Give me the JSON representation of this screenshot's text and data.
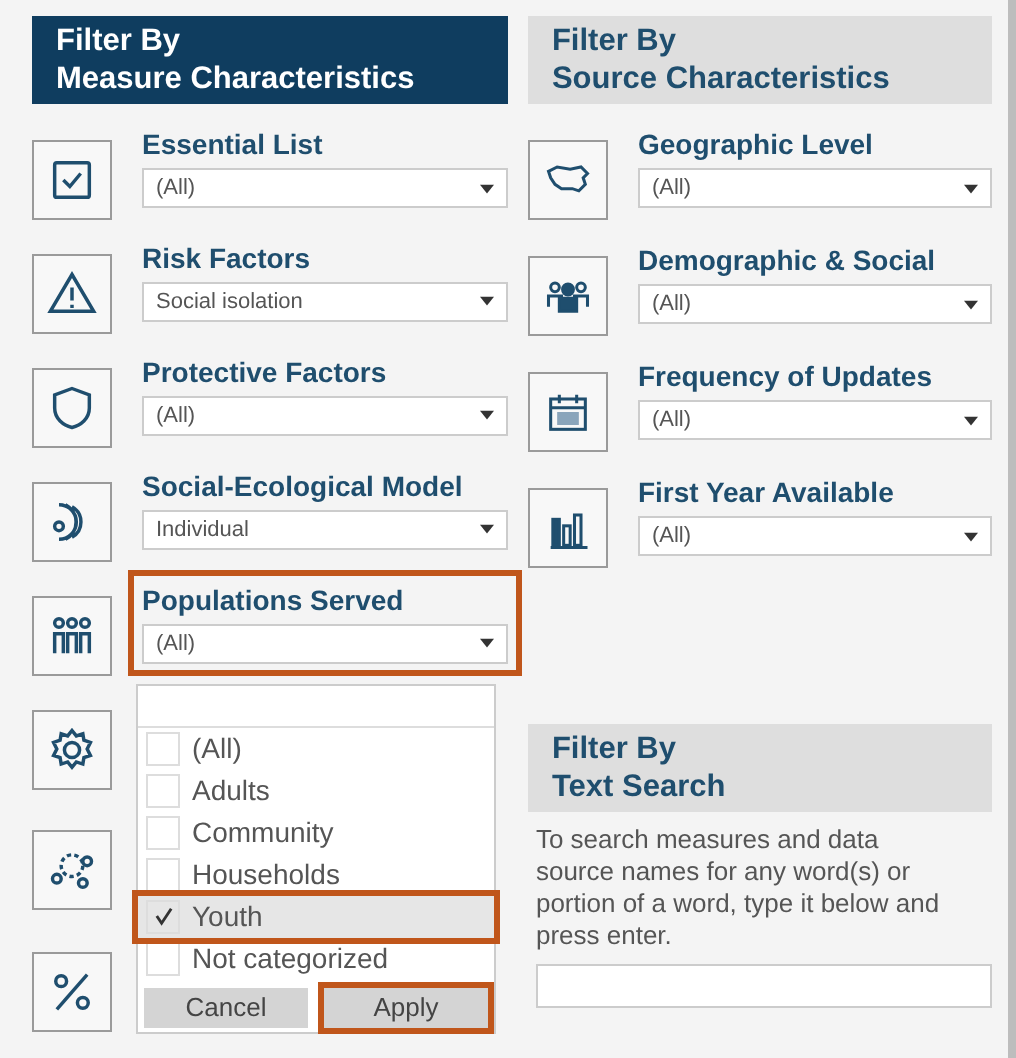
{
  "measure_panel": {
    "title_lines": [
      "Filter By",
      "Measure Characteristics"
    ],
    "selected": true,
    "filters": [
      {
        "label": "Essential List",
        "value": "(All)",
        "highlighted": false
      },
      {
        "label": "Risk Factors",
        "value": "Social isolation",
        "highlighted": false
      },
      {
        "label": "Protective Factors",
        "value": "(All)",
        "highlighted": false
      },
      {
        "label": "Social-Ecological Model",
        "value": "Individual",
        "highlighted": false
      },
      {
        "label": "Populations Served",
        "value": "(All)",
        "highlighted": true
      }
    ]
  },
  "dropdown": {
    "options": [
      {
        "label": "(All)",
        "checked": false,
        "highlighted": false
      },
      {
        "label": "Adults",
        "checked": false,
        "highlighted": false
      },
      {
        "label": "Community",
        "checked": false,
        "highlighted": false
      },
      {
        "label": "Households",
        "checked": false,
        "highlighted": false
      },
      {
        "label": "Youth",
        "checked": true,
        "highlighted": true
      },
      {
        "label": "Not categorized",
        "checked": false,
        "highlighted": false
      }
    ],
    "buttons": [
      {
        "label": "Cancel",
        "highlighted": false
      },
      {
        "label": "Apply",
        "highlighted": true
      }
    ]
  },
  "source_panel": {
    "title_lines": [
      "Filter By",
      "Source Characteristics"
    ],
    "selected": false,
    "filters": [
      {
        "label": "Geographic Level",
        "value": "(All)"
      },
      {
        "label": "Demographic & Social",
        "value": "(All)"
      },
      {
        "label": "Frequency of Updates",
        "value": "(All)"
      },
      {
        "label": "First Year Available",
        "value": "(All)"
      }
    ]
  },
  "text_search": {
    "title_lines": [
      "Filter By",
      "Text Search"
    ],
    "selected": false,
    "description": "To search measures and data source names for any word(s) or portion of a word, type it below and press enter."
  }
}
